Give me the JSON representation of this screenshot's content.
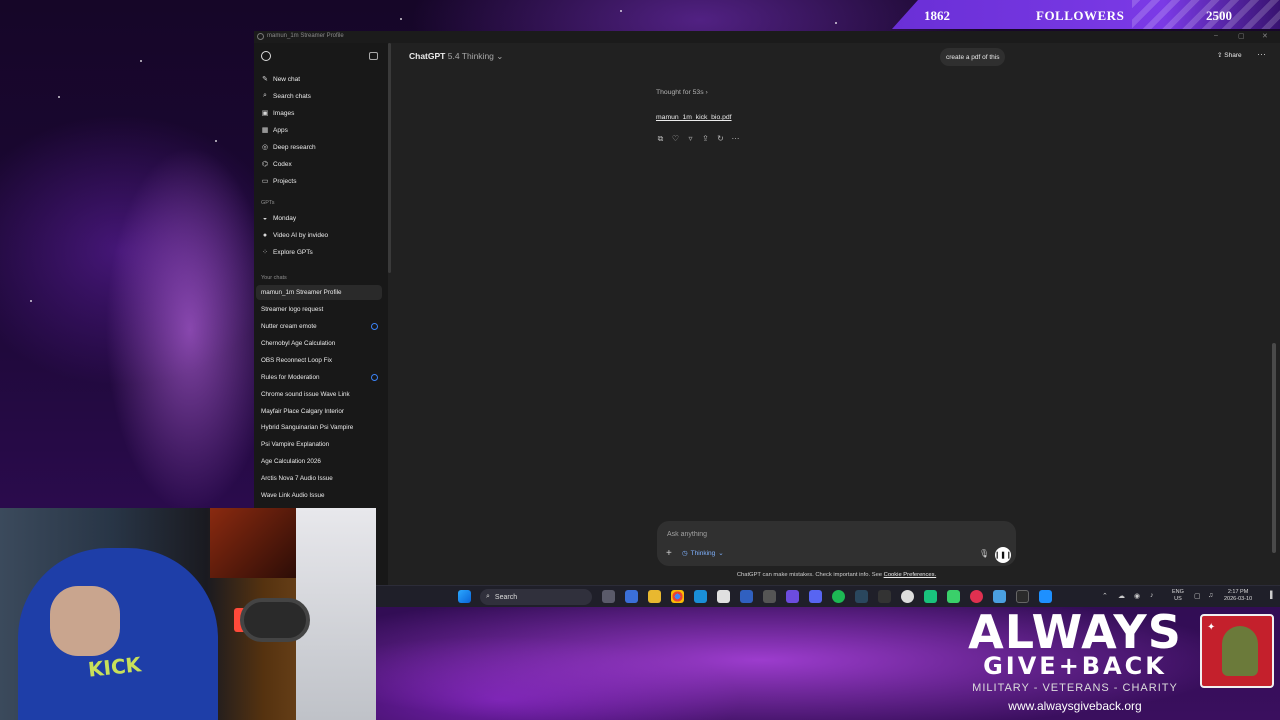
{
  "overlay": {
    "followers_current": "1862",
    "followers_label": "FOLLOWERS",
    "followers_goal": "2500",
    "charity_line1": "ALWAYS",
    "charity_line2": "GIVE+BACK",
    "charity_tagline": "MILITARY - VETERANS - CHARITY",
    "charity_url": "www.alwaysgiveback.org",
    "webcam_shirt_text": "KICK"
  },
  "browser": {
    "tab_title": "mamun_1m Streamer Profile",
    "window_controls": [
      "–",
      "▢",
      "✕"
    ]
  },
  "sidebar": {
    "nav": [
      {
        "label": "New chat",
        "icon": "edit-icon"
      },
      {
        "label": "Search chats",
        "icon": "search-icon"
      },
      {
        "label": "Images",
        "icon": "image-icon"
      },
      {
        "label": "Apps",
        "icon": "apps-icon"
      },
      {
        "label": "Deep research",
        "icon": "telescope-icon"
      },
      {
        "label": "Codex",
        "icon": "code-icon"
      },
      {
        "label": "Projects",
        "icon": "folder-icon"
      }
    ],
    "gpts_heading": "GPTs",
    "gpts": [
      {
        "label": "Monday"
      },
      {
        "label": "Video AI by invideo"
      },
      {
        "label": "Explore GPTs"
      }
    ],
    "chats_heading": "Your chats",
    "chats": [
      {
        "label": "mamun_1m Streamer Profile"
      },
      {
        "label": "Streamer logo request"
      },
      {
        "label": "Nutter cream emote"
      },
      {
        "label": "Chernobyl Age Calculation"
      },
      {
        "label": "OBS Reconnect Loop Fix"
      },
      {
        "label": "Rules for Moderation"
      },
      {
        "label": "Chrome sound issue Wave Link"
      },
      {
        "label": "Mayfair Place Calgary Interior"
      },
      {
        "label": "Hybrid Sanguinarian Psi Vampire"
      },
      {
        "label": "Psi Vampire Explanation"
      },
      {
        "label": "Age Calculation 2026"
      },
      {
        "label": "Arctis Nova 7 Audio Issue"
      },
      {
        "label": "Wave Link Audio Issue"
      }
    ]
  },
  "header": {
    "model_name": "ChatGPT",
    "model_version": "5.4 Thinking",
    "suggestion": "create a pdf of this",
    "share_label": "Share"
  },
  "conversation": {
    "thought_label": "Thought for 53s",
    "file_name": "mamun_1m_kick_bio.pdf"
  },
  "composer": {
    "placeholder": "Ask anything",
    "mode_label": "Thinking",
    "disclaimer_text": "ChatGPT can make mistakes. Check important info. See",
    "disclaimer_link": "Cookie Preferences."
  },
  "taskbar": {
    "search_label": "Search",
    "lang_line1": "ENG",
    "lang_line2": "US",
    "time": "2:17 PM",
    "date": "2026-03-10"
  }
}
